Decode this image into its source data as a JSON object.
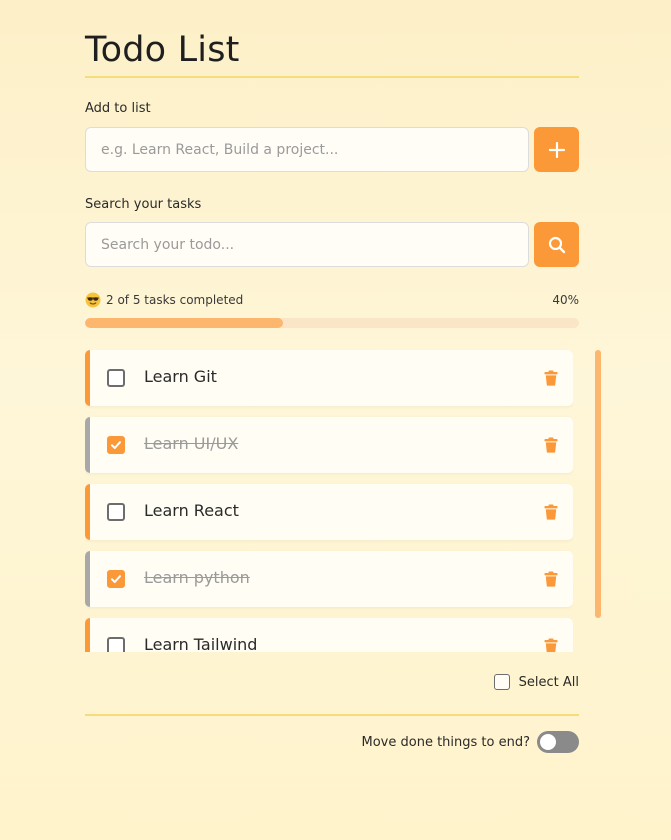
{
  "header": {
    "title": "Todo List"
  },
  "add": {
    "label": "Add to list",
    "placeholder": "e.g. Learn React, Build a project...",
    "value": "",
    "button_icon": "plus-icon"
  },
  "search": {
    "label": "Search your tasks",
    "placeholder": "Search your todo...",
    "value": "",
    "button_icon": "search-icon"
  },
  "progress": {
    "emoji": "sunglasses-face-emoji",
    "status_text": "2 of 5 tasks completed",
    "completed": 2,
    "total": 5,
    "percent": 40,
    "percent_text": "40%"
  },
  "todos": [
    {
      "text": "Learn Git",
      "done": false
    },
    {
      "text": "Learn UI/UX",
      "done": true
    },
    {
      "text": "Learn React",
      "done": false
    },
    {
      "text": "Learn python",
      "done": true
    },
    {
      "text": "Learn Tailwind",
      "done": false
    }
  ],
  "footer": {
    "select_all_label": "Select All",
    "select_all_checked": false,
    "move_done_label": "Move done things to end?",
    "move_done_enabled": false
  },
  "colors": {
    "accent": "#fb9837",
    "progress_fill": "#fdb66e",
    "progress_track": "#fbe5c7",
    "done_bar": "#a8a8a8",
    "toggle_off": "#8a8a8a",
    "rule": "#f6dc7a"
  }
}
